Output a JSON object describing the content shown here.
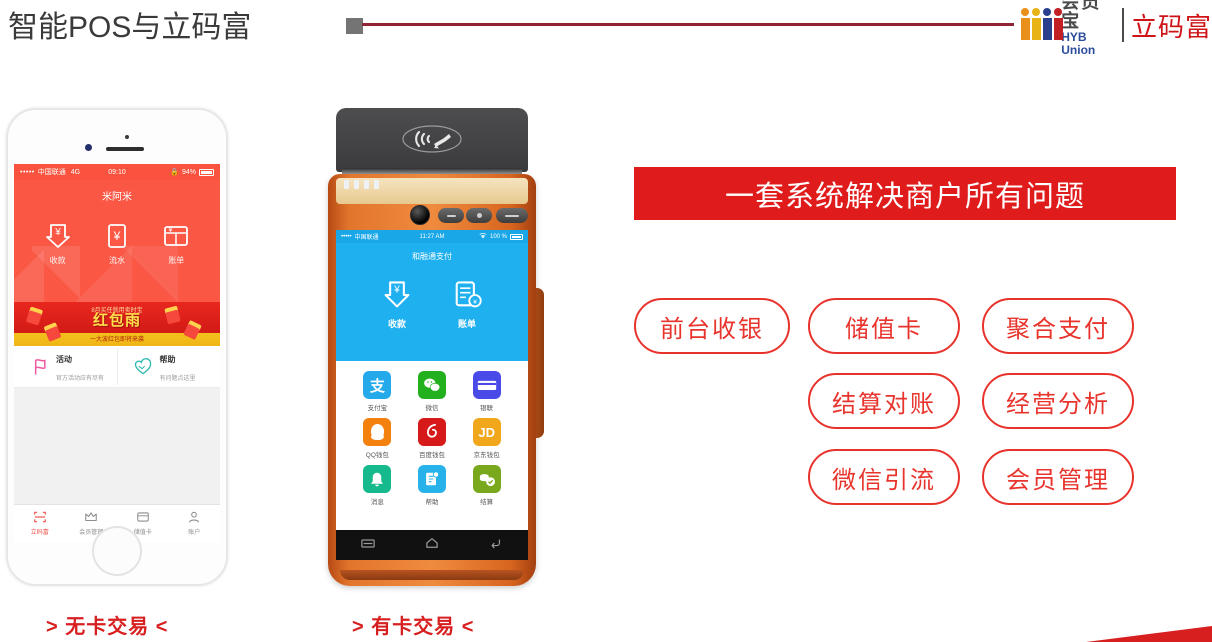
{
  "header": {
    "title": "智能POS与立码富",
    "logo_cn": "会员宝",
    "logo_en": "HYB Union",
    "logo_product": "立码富",
    "people_colors": [
      "#e8901a",
      "#e8b317",
      "#2b3f8f",
      "#c32026"
    ],
    "line_color": "#8e2434",
    "square_color": "#747474"
  },
  "phone": {
    "status": {
      "dots": "•••••",
      "carrier": "中国联通",
      "network": "4G",
      "clock": "09:10",
      "battery_pct": "94%",
      "lock_icon": "lock-icon"
    },
    "app_title": "米阿米",
    "actions": [
      {
        "label": "收款",
        "icon": "receive-money-icon"
      },
      {
        "label": "流水",
        "icon": "transaction-flow-icon"
      },
      {
        "label": "账单",
        "icon": "bill-icon"
      }
    ],
    "promo": {
      "top_text": "8月买任就用卖时宝",
      "title": "红包雨",
      "bottom_text": "一大波红包即将来袭"
    },
    "rows": [
      {
        "label": "活动",
        "sub": "官方活动应有尽有",
        "icon": "flag-icon",
        "color": "#ee5aa0"
      },
      {
        "label": "帮助",
        "sub": "有问题点这里",
        "icon": "handshake-icon",
        "color": "#2fb9b0"
      }
    ],
    "tabs": [
      {
        "label": "立码富",
        "icon": "scan-icon",
        "active": true
      },
      {
        "label": "会员管理",
        "icon": "crown-icon",
        "active": false
      },
      {
        "label": "储值卡",
        "icon": "card-icon",
        "active": false
      },
      {
        "label": "账户",
        "icon": "user-icon",
        "active": false
      }
    ],
    "caption": "> 无卡交易 <"
  },
  "pos": {
    "nfc_icon": "contactless-nfc-icon",
    "status": {
      "dots": "•••••",
      "carrier": "中国联通",
      "clock": "11:27 AM",
      "battery_pct": "100 %",
      "wifi_icon": "wifi-icon"
    },
    "app_title": "和融通支付",
    "actions": [
      {
        "label": "收款",
        "icon": "receive-money-icon"
      },
      {
        "label": "账单",
        "icon": "bill-icon"
      }
    ],
    "apps": [
      {
        "label": "支付宝",
        "glyph": "支",
        "color": "#24aaea",
        "icon": "alipay-icon"
      },
      {
        "label": "微信",
        "glyph": "●●",
        "color": "#22b01f",
        "icon": "wechat-icon"
      },
      {
        "label": "银联",
        "glyph": "▬",
        "color": "#4a4ae8",
        "icon": "unionpay-icon"
      },
      {
        "label": "QQ钱包",
        "glyph": "●",
        "color": "#f4800d",
        "icon": "qq-wallet-icon"
      },
      {
        "label": "百度钱包",
        "glyph": "❀",
        "color": "#d61a1a",
        "icon": "baidu-wallet-icon"
      },
      {
        "label": "京东钱包",
        "glyph": "JD",
        "color": "#f0a71c",
        "icon": "jd-wallet-icon"
      },
      {
        "label": "消息",
        "glyph": "●",
        "color": "#15b98b",
        "icon": "bell-icon"
      },
      {
        "label": "帮助",
        "glyph": "?",
        "color": "#27b3ea",
        "icon": "help-doc-icon"
      },
      {
        "label": "结算",
        "glyph": "✔",
        "color": "#79a81c",
        "icon": "settlement-icon"
      }
    ],
    "nav": [
      {
        "icon": "menu-icon"
      },
      {
        "icon": "home-icon"
      },
      {
        "icon": "back-icon"
      }
    ],
    "caption": "> 有卡交易 <"
  },
  "right_panel": {
    "banner": "一套系统解决商户所有问题",
    "banner_color": "#e01b1b",
    "pill_color": "#e8342d",
    "pills": [
      "前台收银",
      "储值卡",
      "聚合支付",
      "结算对账",
      "经营分析",
      "微信引流",
      "会员管理"
    ]
  },
  "corner_color": "#d81f20"
}
